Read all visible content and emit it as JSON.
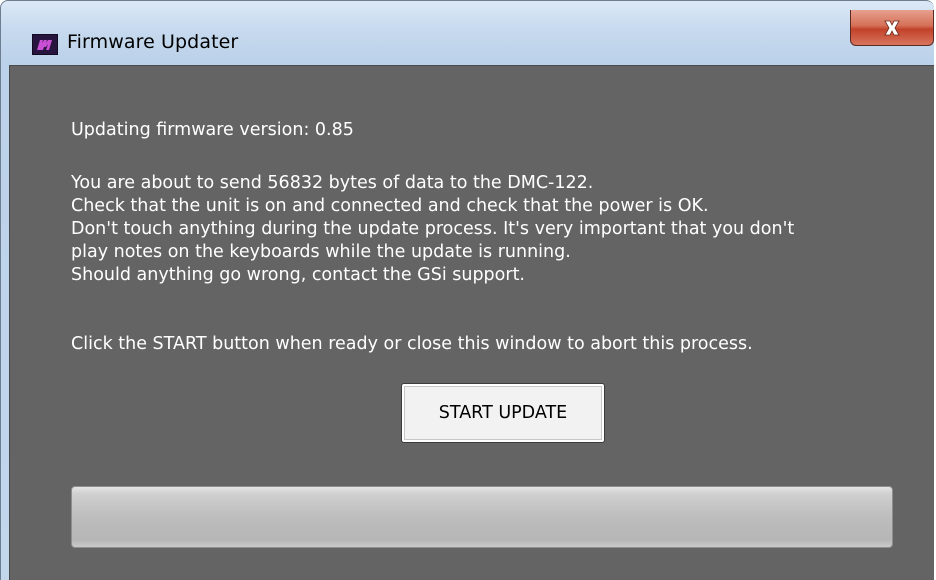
{
  "window": {
    "title": "Firmware Updater",
    "app_icon": "app-logo-icon",
    "close_icon": "close-icon",
    "close_label": "x"
  },
  "content": {
    "version_line": "Updating firmware version: 0.85",
    "body_lines": [
      "You are about to send 56832 bytes of data to the DMC-122.",
      "Check that the unit is on and connected and check that the power is OK.",
      "Don't touch anything during the update process. It's very important that you don't",
      "play notes on the keyboards while the update is running.",
      "Should anything go wrong, contact the GSi support."
    ],
    "instruction_line": "Click the START button when ready or close this window to abort this process."
  },
  "start_button": {
    "label": "START UPDATE"
  },
  "progress": {
    "value_fraction": 0
  },
  "colors": {
    "client_background": "#646464",
    "text": "#ffffff",
    "close_button": "#c2412a",
    "progress_track": "#bdbdbd"
  }
}
